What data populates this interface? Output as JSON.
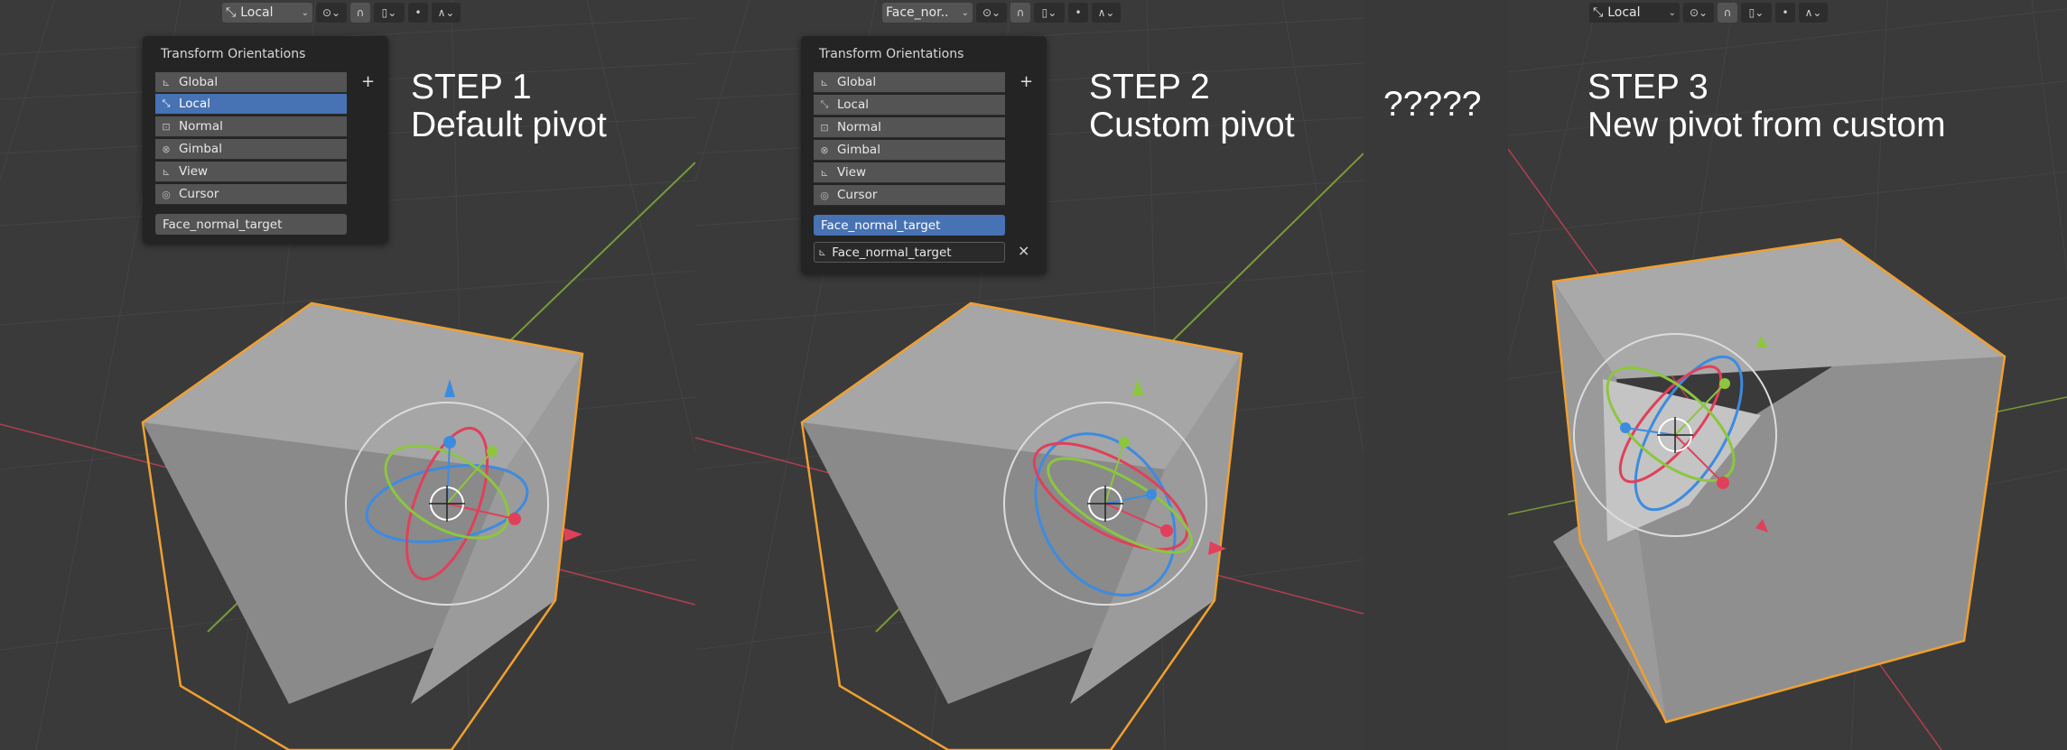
{
  "toolbar": {
    "orientation_values": [
      "Local",
      "Face_nor..",
      "Local"
    ]
  },
  "popup": {
    "title": "Transform Orientations",
    "options": [
      "Global",
      "Local",
      "Normal",
      "Gimbal",
      "View",
      "Cursor"
    ],
    "custom_orientation": "Face_normal_target",
    "add_label": "+",
    "delete_label": "×"
  },
  "steps": [
    {
      "heading": "STEP 1",
      "subheading": "Default pivot"
    },
    {
      "heading": "STEP 2",
      "subheading": "Custom pivot"
    },
    {
      "heading": "STEP 3",
      "subheading": "New pivot from custom"
    }
  ],
  "between_label": "?????",
  "colors": {
    "viewport_bg": "#3a3a3a",
    "selection_outline": "#f0a030",
    "active_item": "#4772b3",
    "axis_x": "#e0405a",
    "axis_y": "#8cc63f",
    "axis_z": "#3d8be0"
  },
  "icons": [
    "orientation-icon",
    "pivot-icon",
    "snap-icon",
    "proportional-icon",
    "falloff-icon",
    "plus-icon",
    "close-icon"
  ]
}
